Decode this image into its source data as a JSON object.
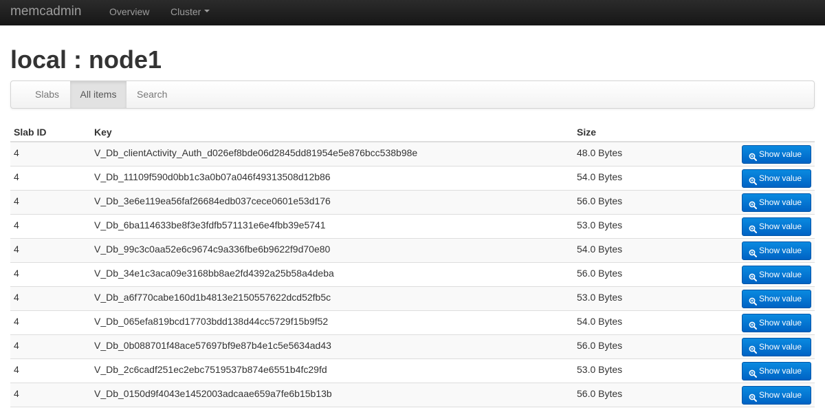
{
  "navbar": {
    "brand": "memcadmin",
    "links": [
      {
        "label": "Overview"
      },
      {
        "label": "Cluster"
      }
    ]
  },
  "page": {
    "title": "local : node1"
  },
  "tabs": [
    {
      "label": "Slabs",
      "active": false
    },
    {
      "label": "All items",
      "active": true
    },
    {
      "label": "Search",
      "active": false
    }
  ],
  "table": {
    "headers": [
      "Slab ID",
      "Key",
      "Size",
      ""
    ],
    "button_label": "Show value",
    "rows": [
      {
        "slab": "4",
        "key": "V_Db_clientActivity_Auth_d026ef8bde06d2845dd81954e5e876bcc538b98e",
        "size": "48.0 Bytes"
      },
      {
        "slab": "4",
        "key": "V_Db_11109f590d0bb1c3a0b07a046f49313508d12b86",
        "size": "54.0 Bytes"
      },
      {
        "slab": "4",
        "key": "V_Db_3e6e119ea56faf26684edb037cece0601e53d176",
        "size": "56.0 Bytes"
      },
      {
        "slab": "4",
        "key": "V_Db_6ba114633be8f3e3fdfb571131e6e4fbb39e5741",
        "size": "53.0 Bytes"
      },
      {
        "slab": "4",
        "key": "V_Db_99c3c0aa52e6c9674c9a336fbe6b9622f9d70e80",
        "size": "54.0 Bytes"
      },
      {
        "slab": "4",
        "key": "V_Db_34e1c3aca09e3168bb8ae2fd4392a25b58a4deba",
        "size": "56.0 Bytes"
      },
      {
        "slab": "4",
        "key": "V_Db_a6f770cabe160d1b4813e2150557622dcd52fb5c",
        "size": "53.0 Bytes"
      },
      {
        "slab": "4",
        "key": "V_Db_065efa819bcd17703bdd138d44cc5729f15b9f52",
        "size": "54.0 Bytes"
      },
      {
        "slab": "4",
        "key": "V_Db_0b088701f48ace57697bf9e87b4e1c5e5634ad43",
        "size": "56.0 Bytes"
      },
      {
        "slab": "4",
        "key": "V_Db_2c6cadf251ec2ebc7519537b874e6551b4fc29fd",
        "size": "53.0 Bytes"
      },
      {
        "slab": "4",
        "key": "V_Db_0150d9f4043e1452003adcaae659a7fe6b15b13b",
        "size": "56.0 Bytes"
      }
    ]
  },
  "colors": {
    "navbar_bg": "#1f1f1f",
    "button_primary": "#0a75d6",
    "active_tab_bg": "#e2e2e2"
  },
  "icons": {
    "button_icon": "zoom-in-icon",
    "dropdown_icon": "caret-down-icon"
  }
}
